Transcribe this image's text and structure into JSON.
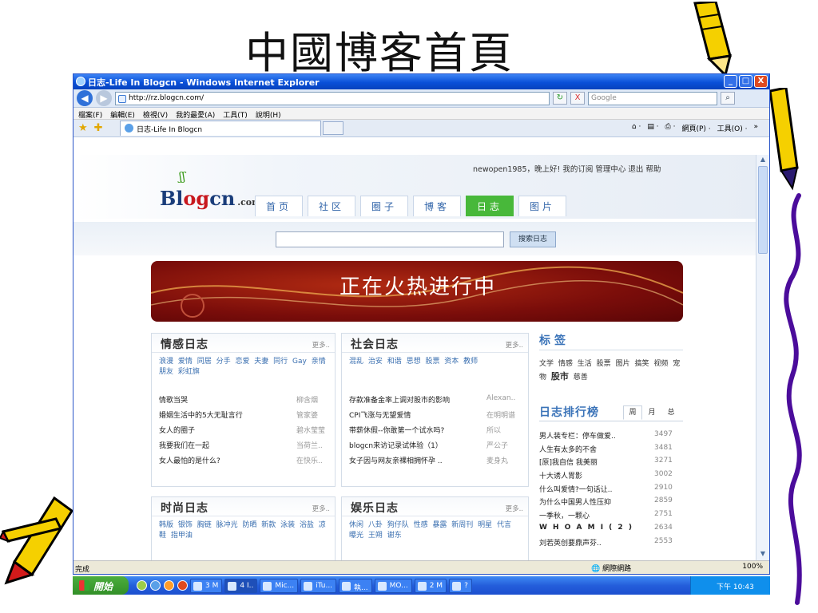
{
  "slide": {
    "title": "中國博客首頁"
  },
  "window": {
    "title": "日志-Life In Blogcn - Windows Internet Explorer",
    "controls": {
      "minimize": "_",
      "maximize": "□",
      "close": "X"
    }
  },
  "address": {
    "url": "http://rz.blogcn.com/",
    "search_placeholder": "Google",
    "refresh": "↻",
    "stop": "X"
  },
  "menu": [
    "檔案(F)",
    "編輯(E)",
    "檢視(V)",
    "我的最愛(A)",
    "工具(T)",
    "說明(H)"
  ],
  "tab": {
    "label": "日志-Life In Blogcn"
  },
  "toolbar": {
    "home": "⌂ ·",
    "feeds": "▤ ·",
    "print": "⎙ ·",
    "page": "網頁(P) ·",
    "tools": "工具(O) ·",
    "more": "»"
  },
  "site": {
    "user_links": "newopen1985，晚上好!  我的订阅  管理中心  退出  帮助",
    "logo": {
      "b": "Bl",
      "o": "o",
      "g": "g",
      "cn": "cn",
      "com": ".com"
    },
    "nav": [
      "首页",
      "社区",
      "圈子",
      "博客",
      "日志",
      "图片"
    ],
    "active_nav": "日志",
    "search_button": "搜索日志",
    "banner_text": "正在火热进行中"
  },
  "panels": {
    "emotion": {
      "title": "情感日志",
      "more": "更多..",
      "tags": "浪漫 爱情 同居 分手 恋爱 夫妻 同行 Gay 亲情 朋友 彩虹旗",
      "rows": [
        {
          "title": "情歌当哭",
          "author": "柳含烟"
        },
        {
          "title": "婚姻生活中的5大无耻言行",
          "author": "管家婆"
        },
        {
          "title": "女人的圈子",
          "author": "碧水莹莹"
        },
        {
          "title": "我要我们在一起",
          "author": "当荷兰.."
        },
        {
          "title": "女人最怕的是什么?",
          "author": "在快乐.."
        }
      ]
    },
    "society": {
      "title": "社会日志",
      "more": "更多..",
      "tags": "混乱 治安 和谐 思想 股票 资本 教师",
      "rows": [
        {
          "title": "存款准备金率上调对股市的影响",
          "author": "Alexan.."
        },
        {
          "title": "CPI飞涨与无望爱情",
          "author": "在明明谱"
        },
        {
          "title": "带薪休假--你敢第一个试水吗?",
          "author": "所以"
        },
        {
          "title": "blogcn来访记录试体验（1）",
          "author": "严公子"
        },
        {
          "title": "女子因与网友亲裸相拥怀孕 ..",
          "author": "麦身丸"
        }
      ]
    },
    "fashion": {
      "title": "时尚日志",
      "more": "更多..",
      "tags": "韩版 银饰 胸链 脉冲光 防晒 新款 泳装 浴盐 凉鞋 指甲油"
    },
    "entertainment": {
      "title": "娱乐日志",
      "more": "更多..",
      "tags": "休闲 八卦 狗仔队 性感 暴露 新周刊 明星 代言 曝光 王朔 谢东"
    }
  },
  "sidebar": {
    "tags_title": "标签",
    "tags": [
      "文学",
      "情感",
      "生活",
      "股票",
      "图片",
      "搞笑",
      "视频",
      "宠物",
      "股市",
      "慈善"
    ],
    "bold_tag": "股市",
    "rank_title": "日志排行榜",
    "rank_tabs": [
      "周",
      "月",
      "总"
    ],
    "rank_active": "周",
    "rank_rows": [
      {
        "title": "男人装专栏：停车做爱..",
        "count": "3497"
      },
      {
        "title": "人生有太多的不舍",
        "count": "3481"
      },
      {
        "title": "[原]我自信 我美丽",
        "count": "3271"
      },
      {
        "title": "十大诱人胃影",
        "count": "3002"
      },
      {
        "title": "什么叫爱情?一句话让..",
        "count": "2910"
      },
      {
        "title": "为什么中国男人性压抑",
        "count": "2859"
      },
      {
        "title": "一季秋，一颗心",
        "count": "2751"
      },
      {
        "title": "W H O   A M   I ( 2 )",
        "count": "2634"
      },
      {
        "title": "刘若英创要鼎声芬..",
        "count": "2553"
      }
    ]
  },
  "status": {
    "text": "完成",
    "zone": "網際網路",
    "zoom": "100%"
  },
  "taskbar": {
    "start": "開始",
    "buttons": [
      "3 M",
      "4 I..",
      "Mic...",
      "iTu...",
      "執...",
      "MO...",
      "2 M",
      "?"
    ],
    "active_index": 1,
    "clock": "下午 10:43"
  },
  "colors": {
    "ie_blue": "#0a50d8",
    "nav_active": "#48b83a",
    "banner": "#7a0d0a",
    "link": "#3a6fb0"
  }
}
